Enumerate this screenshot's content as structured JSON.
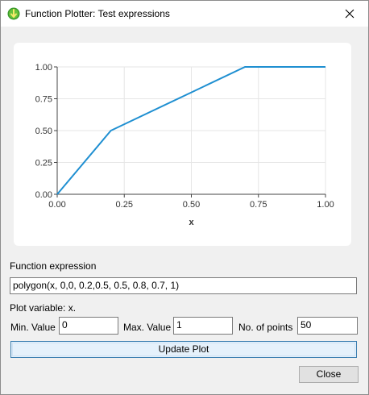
{
  "window": {
    "title": "Function Plotter: Test expressions",
    "app_icon": "green-circle-arrow-icon",
    "close_icon": "close-icon"
  },
  "chart_data": {
    "type": "line",
    "series": [
      {
        "x": [
          0,
          0.2,
          0.5,
          0.7,
          1.0
        ],
        "y": [
          0,
          0.5,
          0.8,
          1.0,
          1.0
        ]
      }
    ],
    "xlabel": "x",
    "ylabel": "",
    "xlim": [
      0,
      1
    ],
    "ylim": [
      0,
      1
    ],
    "x_ticks": [
      "0.00",
      "0.25",
      "0.50",
      "0.75",
      "1.00"
    ],
    "y_ticks": [
      "0.00",
      "0.25",
      "0.50",
      "0.75",
      "1.00"
    ],
    "grid": true,
    "line_color": "#1f8fd1"
  },
  "form": {
    "function_label": "Function expression",
    "function_value": "polygon(x, 0,0, 0.2,0.5, 0.5, 0.8, 0.7, 1)",
    "plot_variable_text": "Plot variable: x.",
    "min_label": "Min. Value",
    "min_value": "0",
    "max_label": "Max. Value",
    "max_value": "1",
    "points_label": "No. of points",
    "points_value": "50",
    "update_label": "Update Plot",
    "close_label": "Close"
  }
}
